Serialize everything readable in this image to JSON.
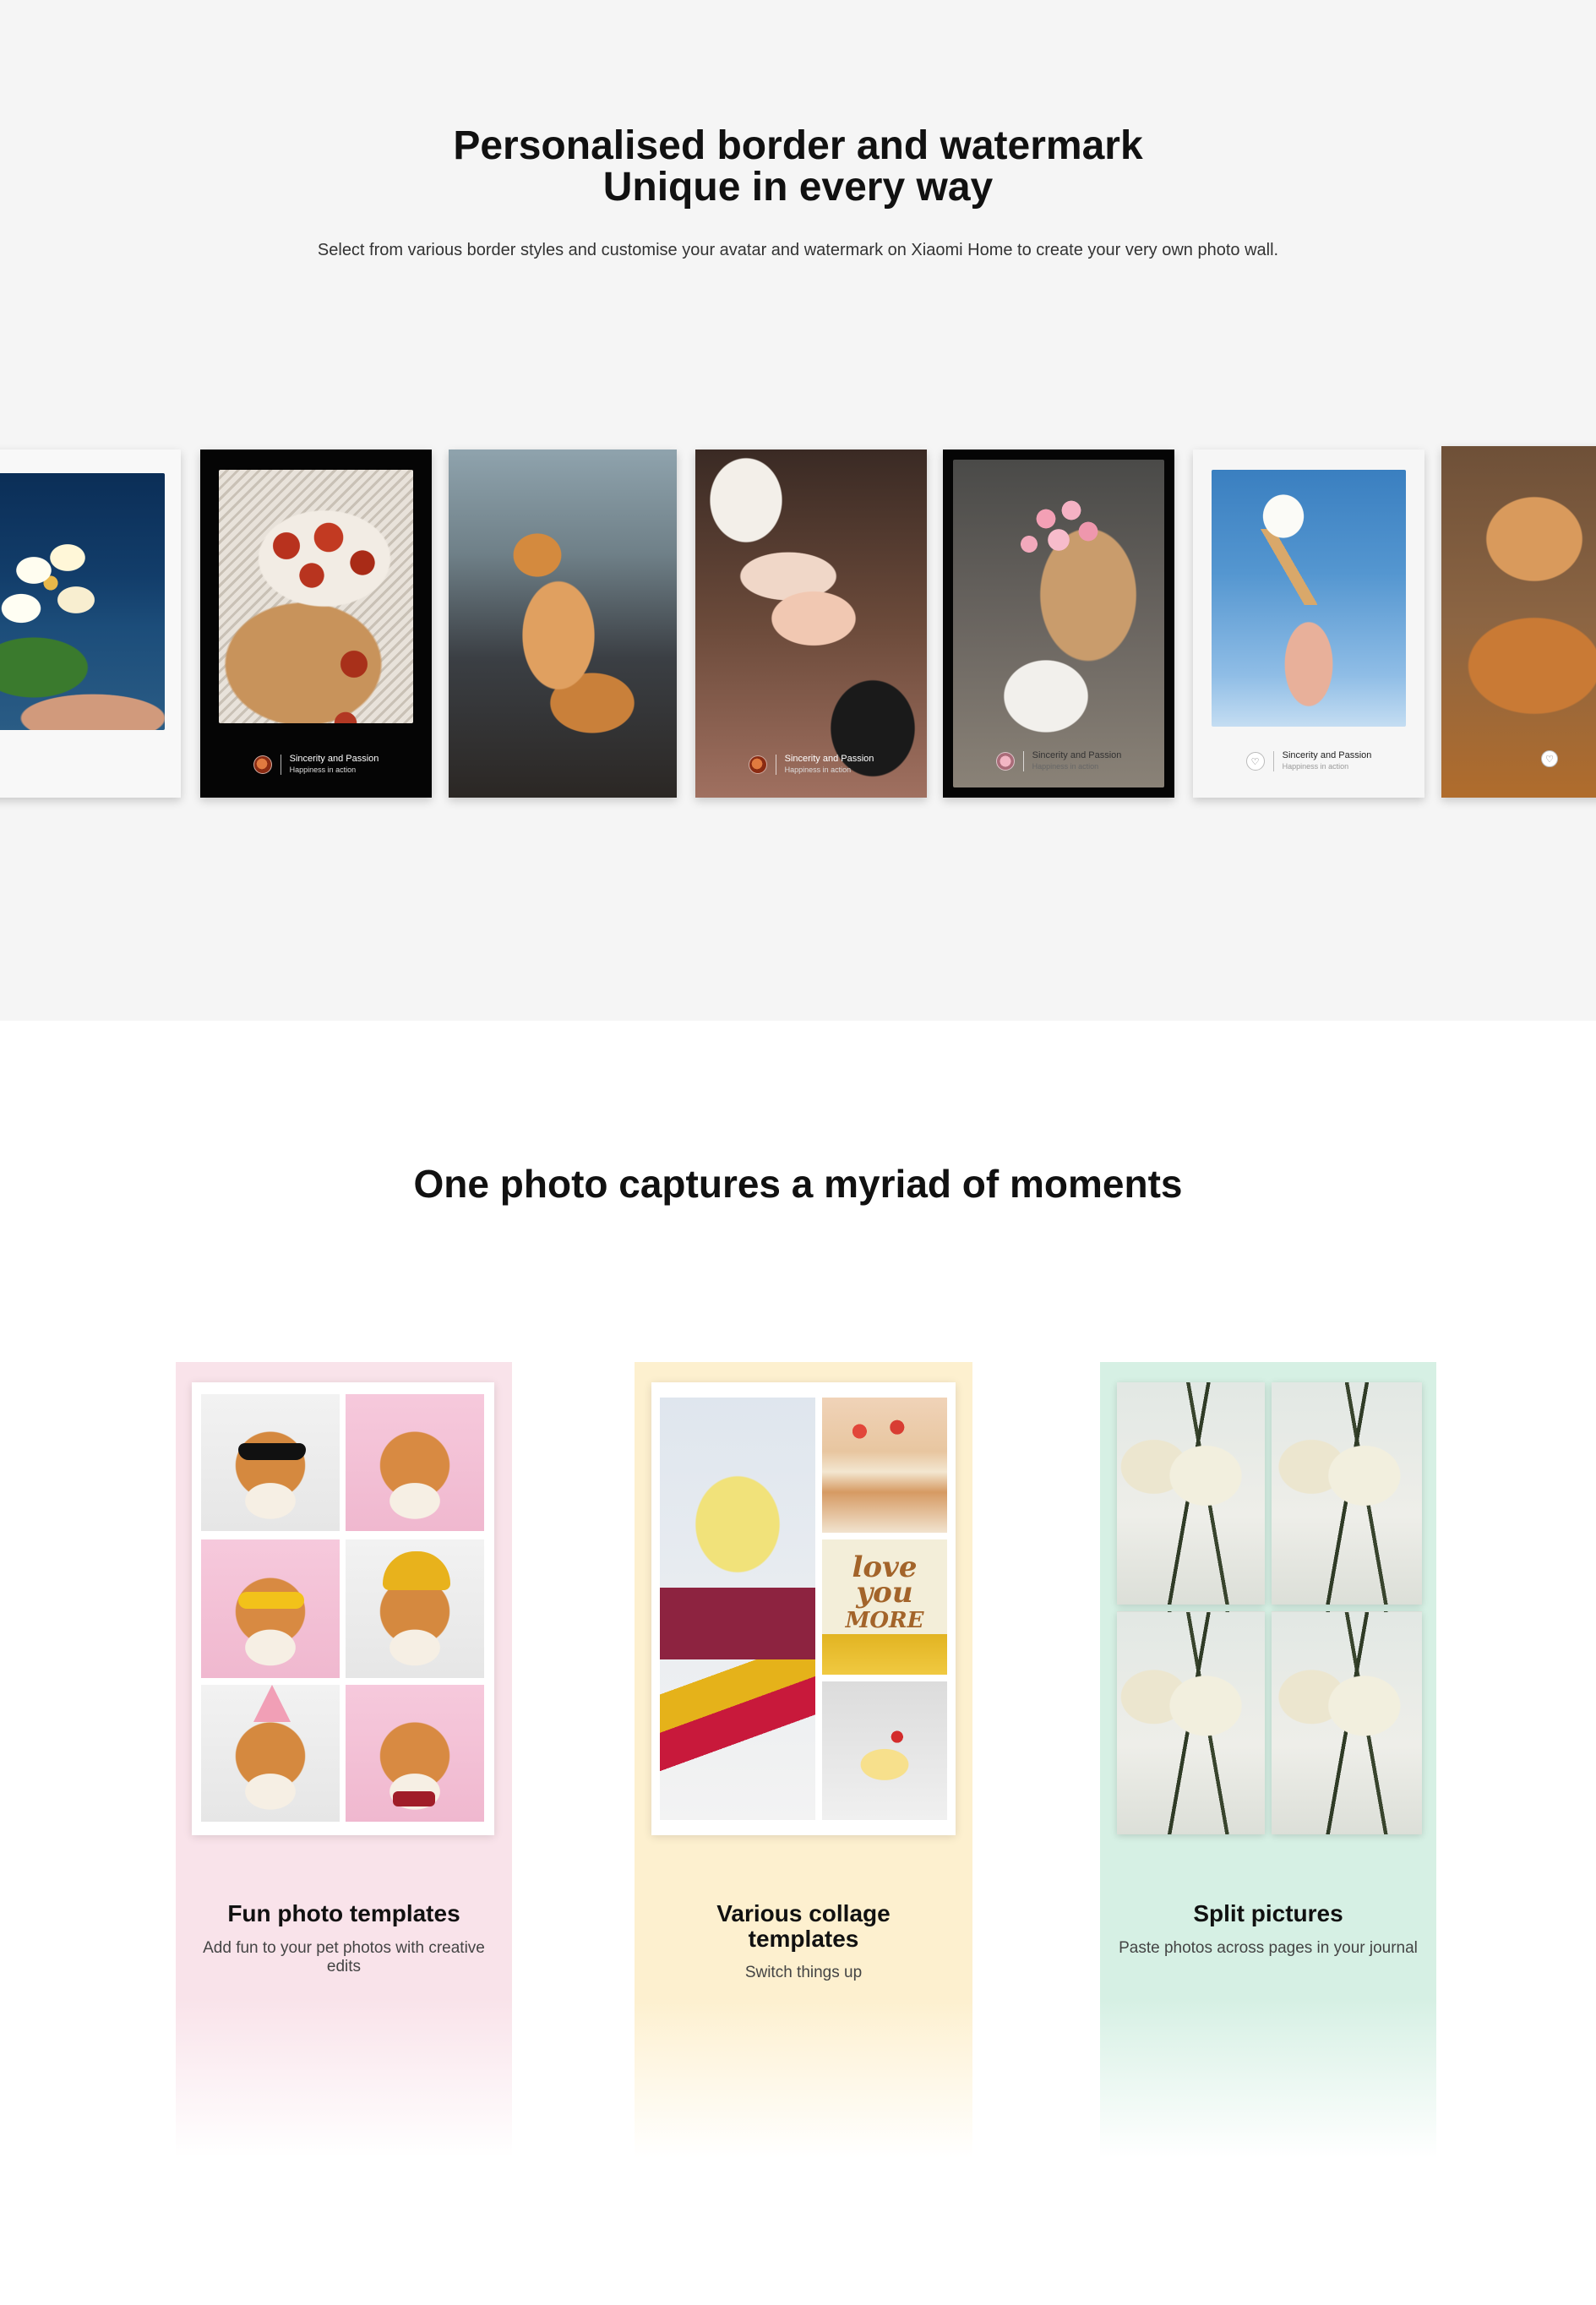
{
  "section1": {
    "title_line1": "Personalised border and watermark",
    "title_line2": "Unique in every way",
    "subtitle": "Select from various border styles and customise your avatar and watermark on Xiaomi Home to create your very own photo wall.",
    "background": "#f5f5f5",
    "cards": [
      {
        "photo": "white flowers on deep blue",
        "frame": "white"
      },
      {
        "photo": "bowl of dried red fruit",
        "frame": "black",
        "caption_title": "Sincerity and Passion",
        "caption_sub": "Happiness in action"
      },
      {
        "photo": "orange cat",
        "frame": "none"
      },
      {
        "photo": "hands with ring",
        "frame": "none",
        "caption_title": "Sincerity and Passion",
        "caption_sub": "Happiness in action"
      },
      {
        "photo": "pink bouquet",
        "frame": "black",
        "caption_title": "Sincerity and Passion",
        "caption_sub": "Happiness in action"
      },
      {
        "photo": "ice cream cone against sky",
        "frame": "white",
        "caption_title": "Sincerity and Passion",
        "caption_sub": "Happiness in action"
      },
      {
        "photo": "orange cat lying",
        "frame": "none"
      }
    ]
  },
  "section2": {
    "title": "One photo captures a myriad of moments",
    "features": [
      {
        "title": "Fun photo templates",
        "desc": "Add fun to your pet photos with creative edits",
        "color": "#f9e3ea"
      },
      {
        "title_line1": "Various collage",
        "title_line2": "templates",
        "desc": "Switch things up",
        "color": "#fdf0cf"
      },
      {
        "title": "Split pictures",
        "desc": "Paste photos across pages in your journal",
        "color": "#d6f0e4"
      }
    ]
  }
}
